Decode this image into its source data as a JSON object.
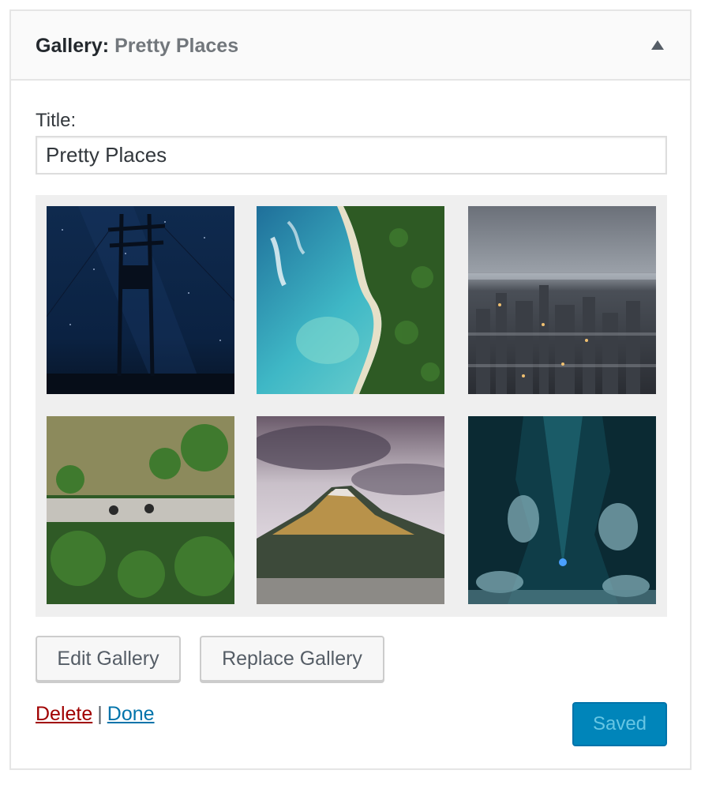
{
  "widget": {
    "label": "Gallery",
    "separator": ":",
    "title_text": "Pretty Places"
  },
  "form": {
    "title_label": "Title:",
    "title_value": "Pretty Places"
  },
  "gallery": {
    "images": [
      {
        "name": "night-sky-power-pole-image"
      },
      {
        "name": "aerial-coastline-image"
      },
      {
        "name": "city-skyline-image"
      },
      {
        "name": "aerial-cyclists-bridge-image"
      },
      {
        "name": "mountain-volcano-image"
      },
      {
        "name": "ice-cave-image"
      }
    ]
  },
  "buttons": {
    "edit_label": "Edit Gallery",
    "replace_label": "Replace Gallery",
    "saved_label": "Saved"
  },
  "links": {
    "delete_label": "Delete",
    "separator": "|",
    "done_label": "Done"
  },
  "colors": {
    "link_blue": "#0073aa",
    "delete_red": "#a00000",
    "primary_button": "#0085ba"
  }
}
